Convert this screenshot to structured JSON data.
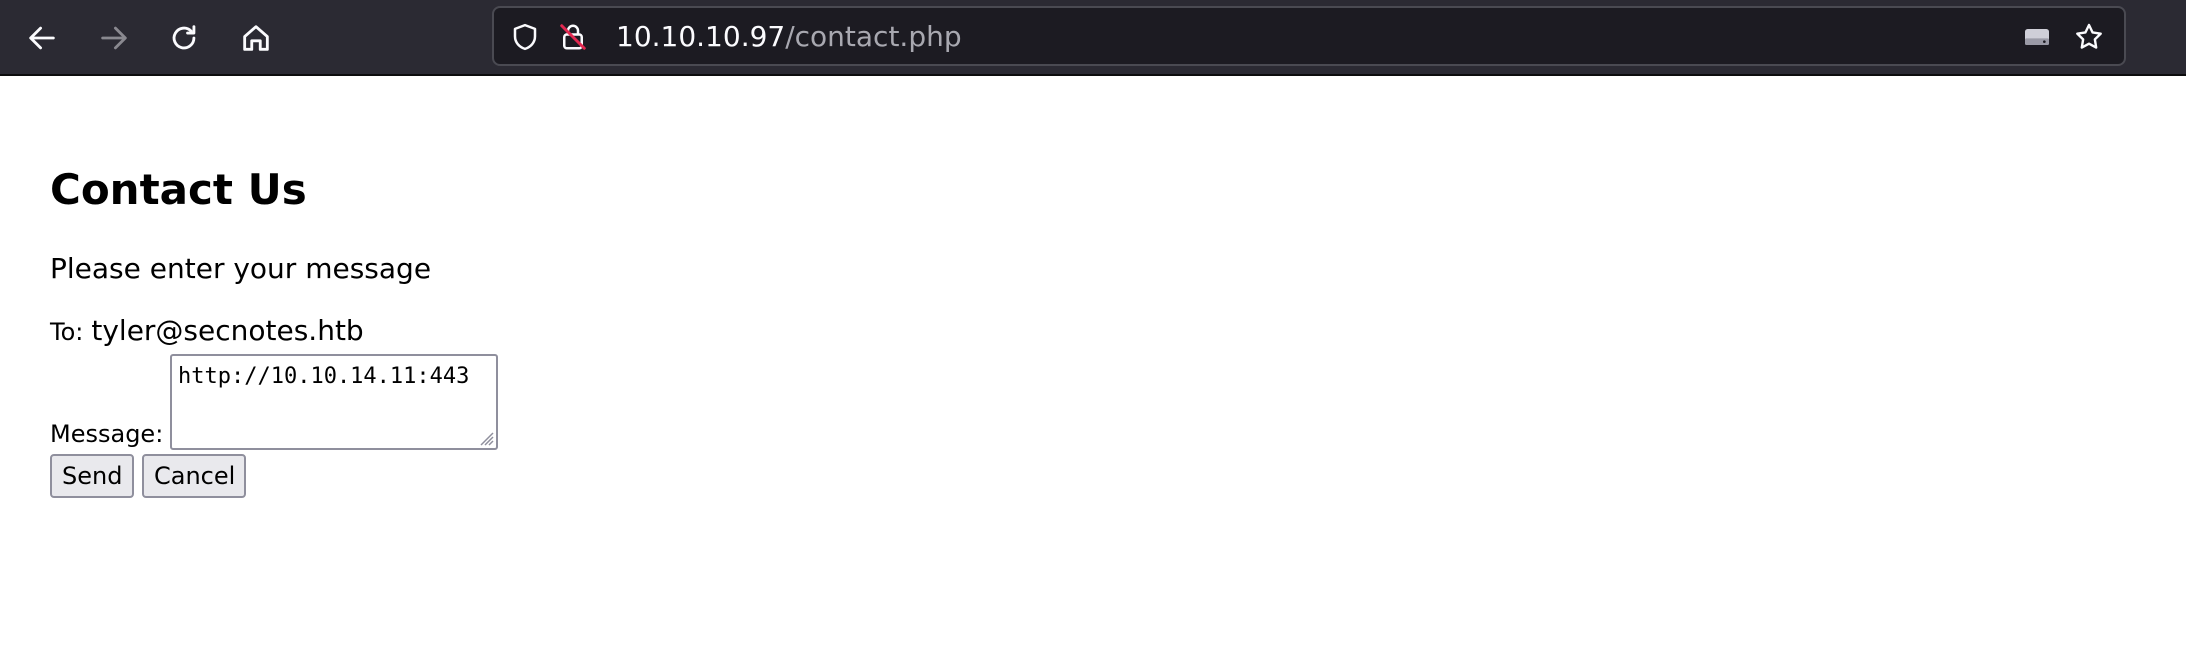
{
  "browser": {
    "url_host": "10.10.10.97",
    "url_path": "/contact.php",
    "icons": {
      "back": "back-arrow-icon",
      "forward": "forward-arrow-icon",
      "reload": "reload-icon",
      "home": "home-icon",
      "shield": "shield-icon",
      "lock": "insecure-lock-icon",
      "drive": "drive-icon",
      "star": "bookmark-star-icon"
    },
    "colors": {
      "toolbar_bg": "#2b2a33",
      "urlbar_bg": "#1c1b22",
      "insecure_accent": "#e22850"
    }
  },
  "page": {
    "title": "Contact Us",
    "intro": "Please enter your message",
    "to_label": "To:",
    "to_value": "tyler@secnotes.htb",
    "message_label": "Message:",
    "message_value": "http://10.10.14.11:443",
    "send_label": "Send",
    "cancel_label": "Cancel"
  }
}
